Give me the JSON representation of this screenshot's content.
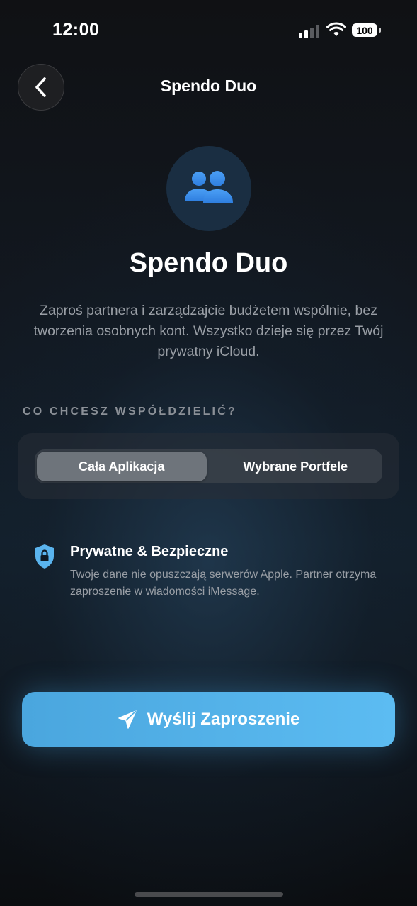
{
  "status_bar": {
    "time": "12:00",
    "battery_level": "100"
  },
  "nav": {
    "back_icon": "chevron-left-icon",
    "title": "Spendo Duo"
  },
  "hero": {
    "icon": "people-icon",
    "title": "Spendo Duo",
    "description": "Zaproś partnera i zarządzajcie budżetem wspólnie, bez tworzenia osobnych kont. Wszystko dzieje się przez Twój prywatny iCloud."
  },
  "share_section": {
    "label": "CO CHCESZ WSPÓŁDZIELIĆ?",
    "options": [
      {
        "label": "Cała Aplikacja",
        "selected": true
      },
      {
        "label": "Wybrane Portfele",
        "selected": false
      }
    ]
  },
  "privacy": {
    "icon": "lock-shield-icon",
    "title": "Prywatne & Bezpieczne",
    "body": "Twoje dane nie opuszczają serwerów Apple. Partner otrzyma zaproszenie w wiadomości iMessage."
  },
  "actions": {
    "send_icon": "paper-plane-icon",
    "send_label": "Wyślij Zaproszenie"
  },
  "colors": {
    "accent": "#56b4ea",
    "icon_blue": "#3d8ff0",
    "background": "#101318"
  }
}
